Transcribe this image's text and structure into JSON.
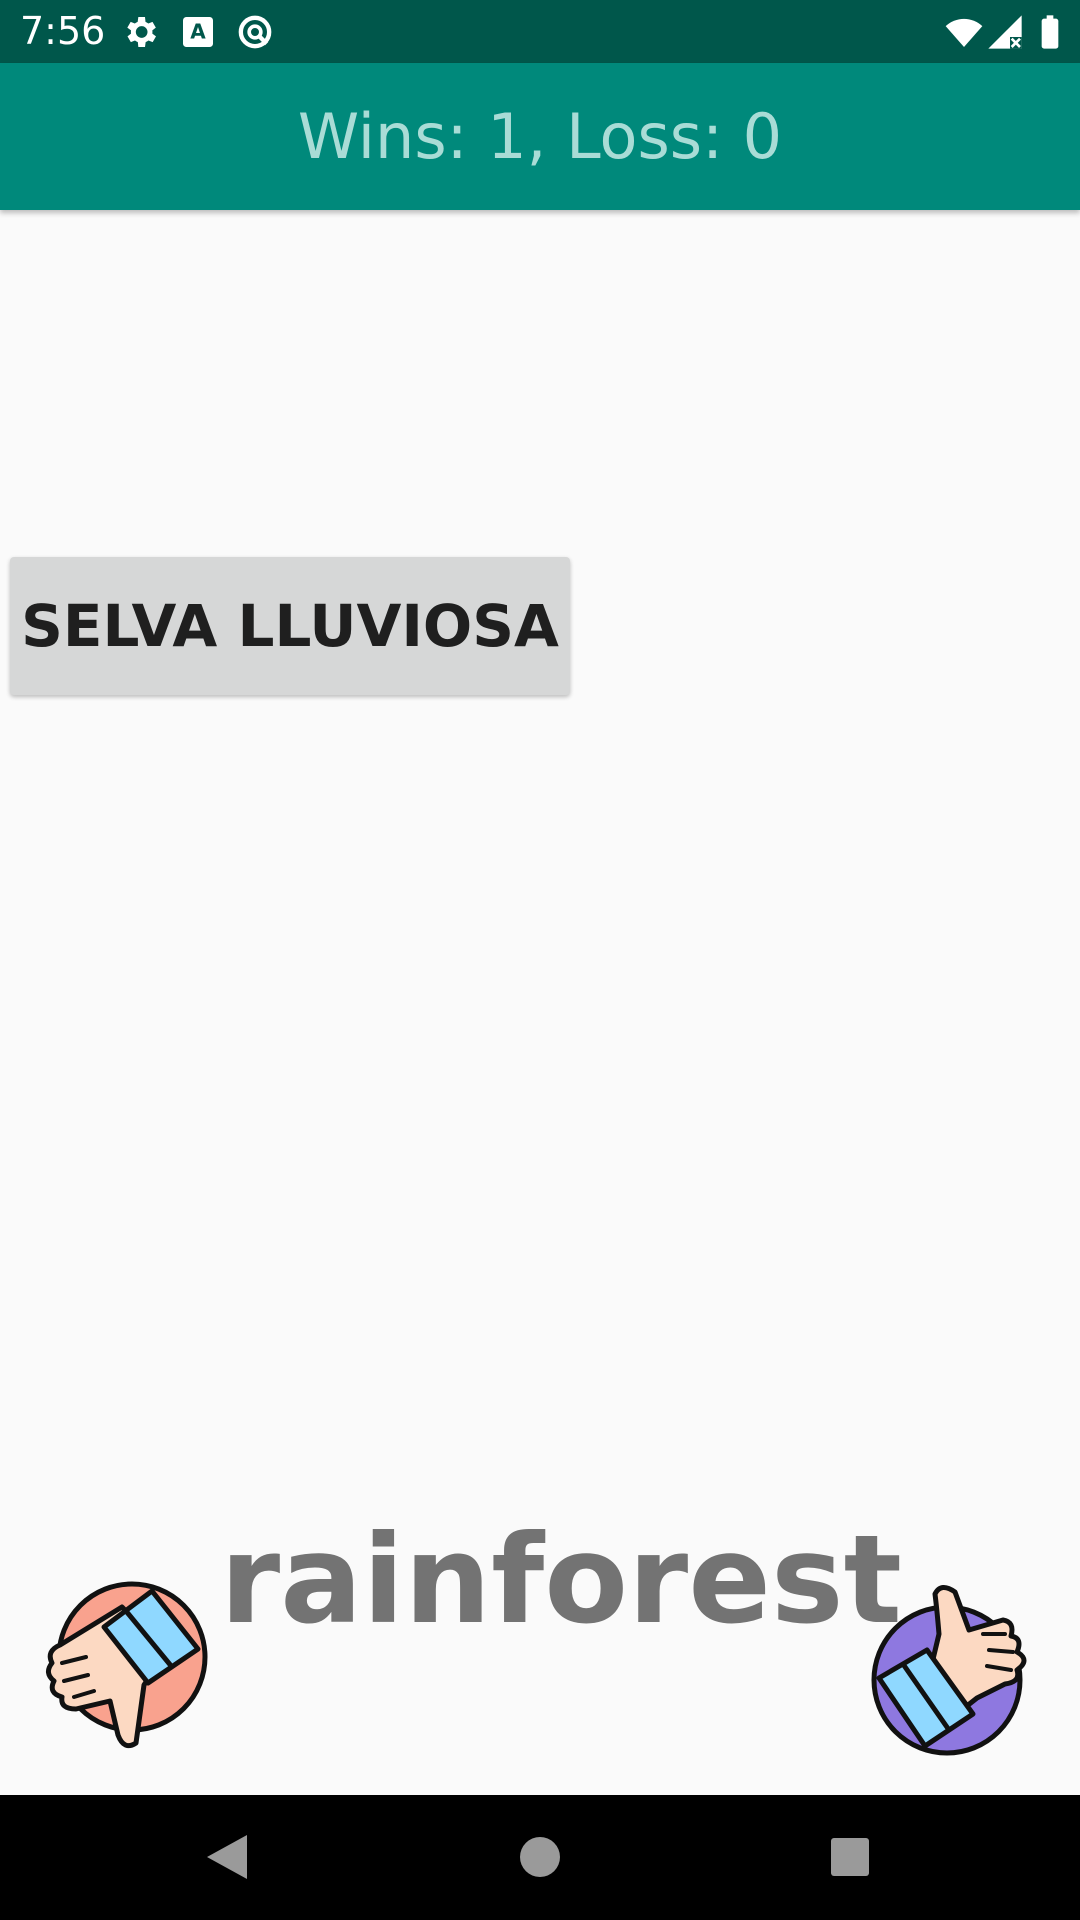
{
  "status_bar": {
    "time": "7:56",
    "icons": [
      "gear-icon",
      "text-a-icon",
      "no-disturb-icon",
      "wifi-icon",
      "signal-icon",
      "battery-icon"
    ]
  },
  "app_bar": {
    "title": "Wins: 1, Loss: 0"
  },
  "main": {
    "answer_button_label": "SELVA LLUVIOSA",
    "word": "rainforest"
  },
  "actions": {
    "thumb_down": "thumbs-down-icon",
    "thumb_up": "thumbs-up-icon"
  },
  "navigation_bar": {
    "icons": [
      "back-icon",
      "home-icon",
      "recents-icon"
    ]
  },
  "colors": {
    "status_bar": "#00574b",
    "app_bar": "#00897b",
    "title_text": "#a9dcd6",
    "button_bg": "#d6d7d7",
    "word_text": "#737373"
  }
}
